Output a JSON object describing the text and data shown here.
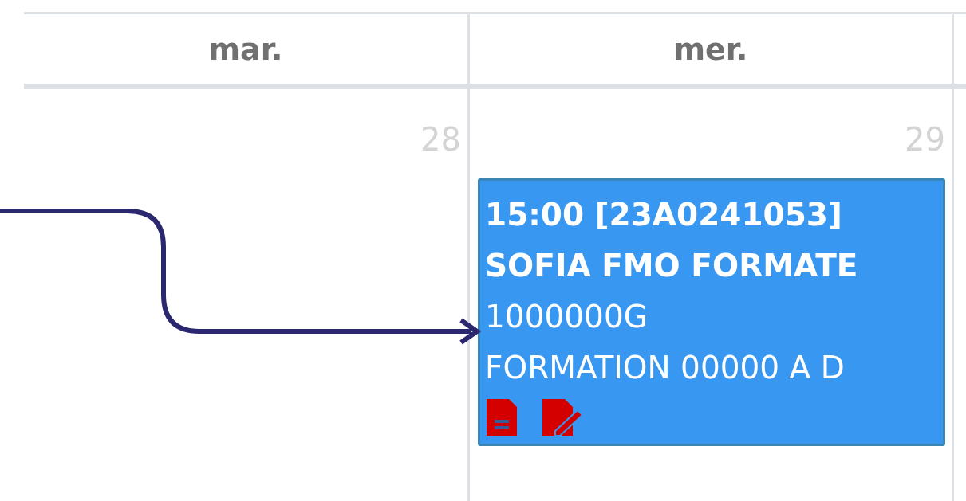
{
  "days": [
    {
      "label": "mar.",
      "date": "28"
    },
    {
      "label": "mer.",
      "date": "29",
      "events": [
        {
          "lines": [
            {
              "text": "15:00 [23A0241053]",
              "bold": true
            },
            {
              "text": "SOFIA FMO FORMATE",
              "bold": true
            },
            {
              "text": "1000000G",
              "bold": false
            },
            {
              "text": "FORMATION 00000 A D",
              "bold": false
            }
          ],
          "icons": [
            {
              "kind": "document"
            },
            {
              "kind": "edit"
            }
          ]
        }
      ]
    }
  ]
}
